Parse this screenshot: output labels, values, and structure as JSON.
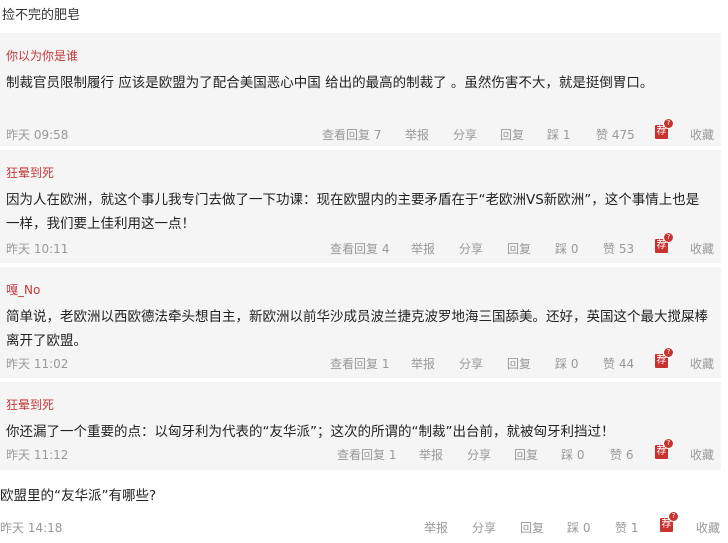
{
  "top": {
    "text": "捡不完的肥皂"
  },
  "replies": [
    {
      "user": "你以为你是谁",
      "content": "制裁官员限制履行 应该是欧盟为了配合美国恶心中国 给出的最高的制裁了 。虽然伤害不大，就是挺倒胃口。",
      "time": "昨天 09:58",
      "view_replies": "查看回复 7",
      "report": "举报",
      "share": "分享",
      "reply": "回复",
      "dislike": "踩 1",
      "like": "赞 475",
      "rec": "荐",
      "rec_badge": "?",
      "collect": "收藏"
    },
    {
      "user": "狂晕到死",
      "content": "因为人在欧洲，就这个事儿我专门去做了一下功课：现在欧盟内的主要矛盾在于“老欧洲VS新欧洲”，这个事情上也是一样，我们要上佳利用这一点！",
      "time": "昨天 10:11",
      "view_replies": "查看回复 4",
      "report": "举报",
      "share": "分享",
      "reply": "回复",
      "dislike": "踩 0",
      "like": "赞 53",
      "rec": "荐",
      "rec_badge": "?",
      "collect": "收藏"
    },
    {
      "user": "嘎_No",
      "content": "简单说，老欧洲以西欧德法牵头想自主，新欧洲以前华沙成员波兰捷克波罗地海三国舔美。还好，英国这个最大搅屎棒离开了欧盟。",
      "time": "昨天 11:02",
      "view_replies": "查看回复 1",
      "report": "举报",
      "share": "分享",
      "reply": "回复",
      "dislike": "踩 0",
      "like": "赞 44",
      "rec": "荐",
      "rec_badge": "?",
      "collect": "收藏"
    },
    {
      "user": "狂晕到死",
      "content": "你还漏了一个重要的点：以匈牙利为代表的“友华派”；这次的所谓的“制裁”出台前，就被匈牙利挡过！",
      "time": "昨天 11:12",
      "view_replies": "查看回复 1",
      "report": "举报",
      "share": "分享",
      "reply": "回复",
      "dislike": "踩 0",
      "like": "赞 6",
      "rec": "荐",
      "rec_badge": "?",
      "collect": "收藏"
    }
  ],
  "final": {
    "content": "欧盟里的“友华派”有哪些?",
    "time": "昨天 14:18",
    "report": "举报",
    "share": "分享",
    "reply": "回复",
    "dislike": "踩 0",
    "like": "赞 1",
    "rec": "荐",
    "rec_badge": "?",
    "collect": "收藏"
  },
  "colors": {
    "username": "#c23b3b",
    "meta": "#999999",
    "card_bg": "#f5f5f5",
    "rec_badge": "#c8322f"
  }
}
